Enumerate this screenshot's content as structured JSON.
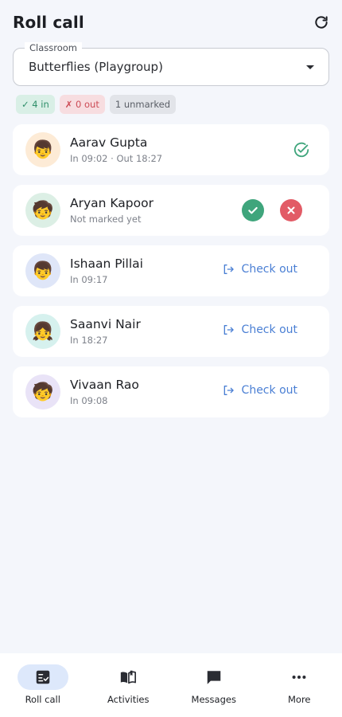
{
  "header": {
    "title": "Roll call",
    "refresh_icon": "refresh-icon"
  },
  "classroom": {
    "label": "Classroom",
    "value": "Butterflies (Playgroup)"
  },
  "chips": {
    "in": "✓ 4 in",
    "out": "✗ 0 out",
    "unmarked": "1 unmarked"
  },
  "children": [
    {
      "name": "Aarav Gupta",
      "detail": "In 09:02 · Out 18:27",
      "avatar": "👦",
      "state": "checked-out"
    },
    {
      "name": "Aryan Kapoor",
      "detail": "Not marked yet",
      "avatar": "🧒",
      "state": "unmarked"
    },
    {
      "name": "Ishaan Pillai",
      "detail": "In 09:17",
      "avatar": "👦",
      "state": "in",
      "action": "Check out"
    },
    {
      "name": "Saanvi Nair",
      "detail": "In 18:27",
      "avatar": "👧",
      "state": "in",
      "action": "Check out"
    },
    {
      "name": "Vivaan Rao",
      "detail": "In 09:08",
      "avatar": "🧒",
      "state": "in",
      "action": "Check out"
    }
  ],
  "nav": [
    {
      "label": "Roll call",
      "icon": "checklist-icon",
      "active": true
    },
    {
      "label": "Activities",
      "icon": "book-icon",
      "active": false
    },
    {
      "label": "Messages",
      "icon": "chat-icon",
      "active": false
    },
    {
      "label": "More",
      "icon": "more-icon",
      "active": false
    }
  ],
  "colors": {
    "accent": "#4a7fd4",
    "present": "#3fa57c",
    "absent": "#e25b66",
    "background": "#f4f6fb"
  }
}
